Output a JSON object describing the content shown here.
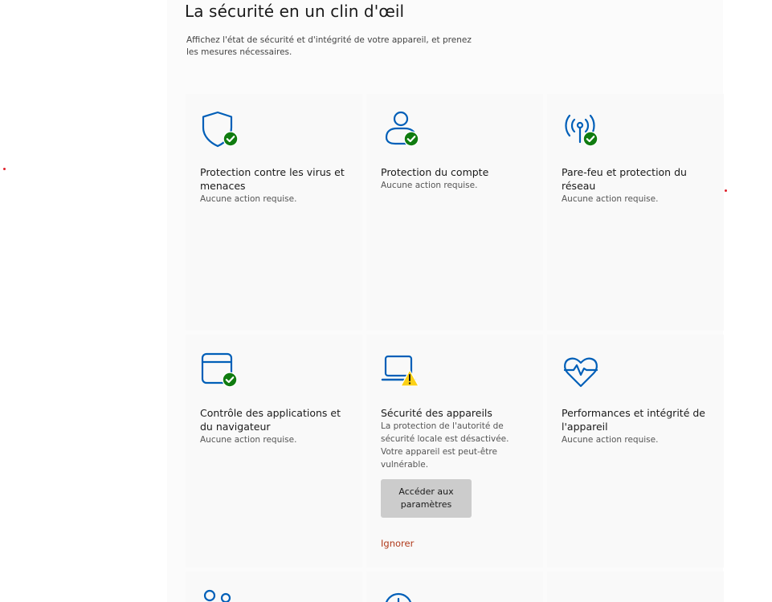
{
  "header": {
    "title": "La sécurité en un clin d'œil",
    "subtitle": "Affichez l'état de sécurité et d'intégrité de votre appareil, et prenez les mesures nécessaires."
  },
  "tiles": [
    {
      "title": "Protection contre les virus et menaces",
      "status": "Aucune action requise.",
      "icon": "shield-icon",
      "badge": "check"
    },
    {
      "title": "Protection du compte",
      "status": "Aucune action requise.",
      "icon": "person-icon",
      "badge": "check"
    },
    {
      "title": "Pare-feu et protection du réseau",
      "status": "Aucune action requise.",
      "icon": "wireless-antenna-icon",
      "badge": "check"
    },
    {
      "title": "Contrôle des applications et du navigateur",
      "status": "Aucune action requise.",
      "icon": "browser-window-icon",
      "badge": "check"
    },
    {
      "title": "Sécurité des appareils",
      "status": "La protection de l'autorité de sécurité locale est désactivée. Votre appareil est peut-être vulnérable.",
      "icon": "laptop-icon",
      "badge": "warning",
      "action_label": "Accéder aux paramètres",
      "dismiss_label": "Ignorer"
    },
    {
      "title": "Performances et intégrité de l'appareil",
      "status": "Aucune action requise.",
      "icon": "heart-pulse-icon",
      "badge": "none"
    }
  ],
  "colors": {
    "accent": "#005fb8",
    "ok": "#107c10",
    "warning": "#fcd116",
    "dismiss": "#b0391a"
  }
}
